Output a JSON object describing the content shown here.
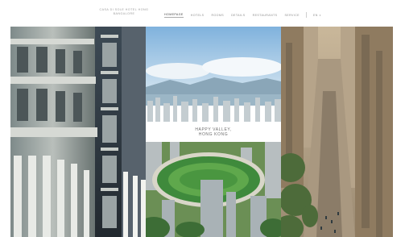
{
  "header": {
    "logo_line1": "CASA DI SOLE HOTEL HONG",
    "logo_line2": "BANGALORE"
  },
  "nav": {
    "items": [
      {
        "label": "HOMEPAGE",
        "active": true
      },
      {
        "label": "HOTELS"
      },
      {
        "label": "ROOMS"
      },
      {
        "label": "DETAILS"
      },
      {
        "label": "RESTAURANTS"
      },
      {
        "label": "SERVICE"
      }
    ],
    "language": "EN"
  },
  "panels": [
    {
      "name": "panel-architecture"
    },
    {
      "name": "panel-happy-valley",
      "caption_line1": "HAPPY VALLEY,",
      "caption_line2": "HONG KONG"
    },
    {
      "name": "panel-avenue"
    }
  ]
}
